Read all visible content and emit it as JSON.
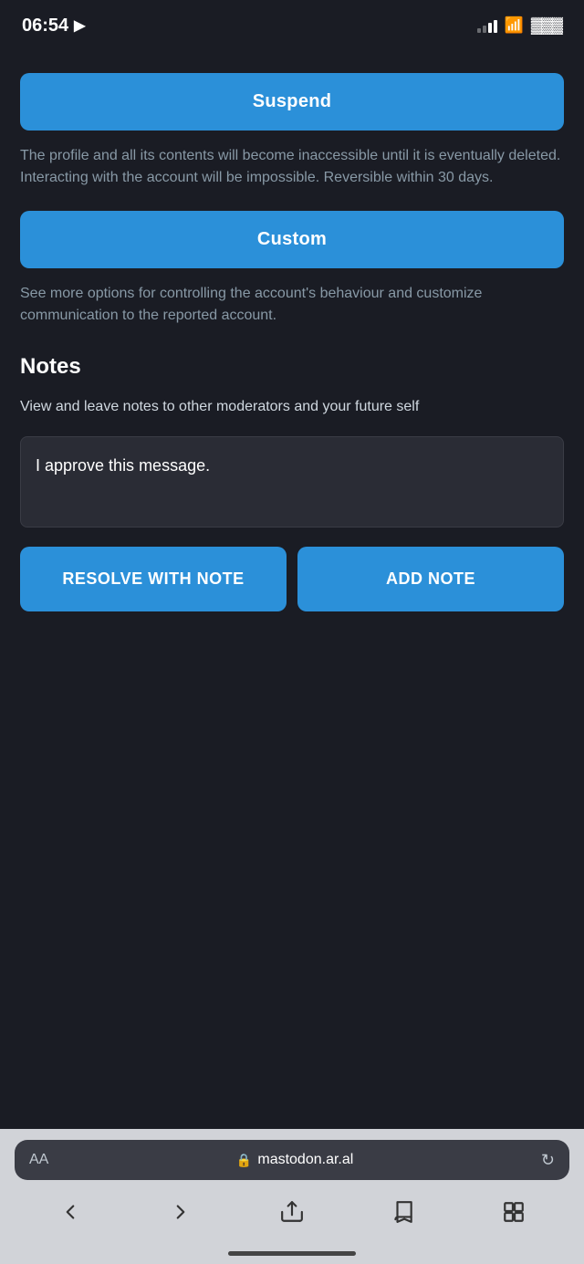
{
  "statusBar": {
    "time": "06:54",
    "locationIcon": "◁",
    "url": "mastodon.ar.al"
  },
  "suspendSection": {
    "buttonLabel": "Suspend",
    "description": "The profile and all its contents will become inaccessible until it is eventually deleted. Interacting with the account will be impossible. Reversible within 30 days."
  },
  "customSection": {
    "buttonLabel": "Custom",
    "description": "See more options for controlling the account's behaviour and customize communication to the reported account."
  },
  "notesSection": {
    "title": "Notes",
    "subtitle": "View and leave notes to other moderators and your future self",
    "placeholder": "",
    "currentText": "I approve this message.",
    "resolveButtonLabel": "RESOLVE WITH NOTE",
    "addNoteButtonLabel": "ADD NOTE"
  },
  "browserBar": {
    "aaLabel": "AA",
    "urlLabel": "mastodon.ar.al"
  }
}
